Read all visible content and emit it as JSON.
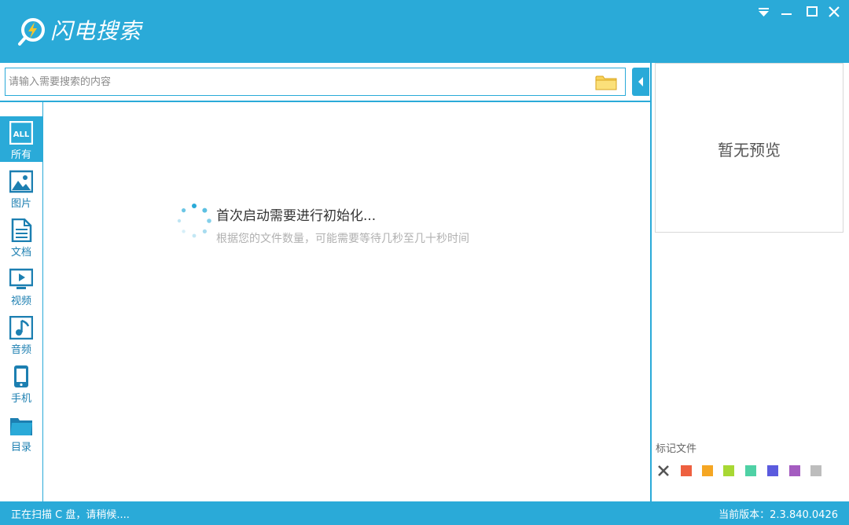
{
  "app": {
    "title": "闪电搜索",
    "accent_color": "#2aaad8"
  },
  "window_controls": [
    "dropdown-icon",
    "minimize-icon",
    "maximize-icon",
    "close-icon"
  ],
  "search": {
    "placeholder": "请输入需要搜索的内容",
    "value": "",
    "browse_icon": "folder-icon"
  },
  "sidebar": {
    "items": [
      {
        "label": "所有",
        "icon": "all-icon",
        "active": true
      },
      {
        "label": "图片",
        "icon": "picture-icon",
        "active": false
      },
      {
        "label": "文档",
        "icon": "document-icon",
        "active": false
      },
      {
        "label": "视频",
        "icon": "video-icon",
        "active": false
      },
      {
        "label": "音频",
        "icon": "audio-icon",
        "active": false
      },
      {
        "label": "手机",
        "icon": "phone-icon",
        "active": false
      },
      {
        "label": "目录",
        "icon": "folder-icon",
        "active": false
      }
    ]
  },
  "main": {
    "init_title": "首次启动需要进行初始化...",
    "init_subtitle": "根据您的文件数量，可能需要等待几秒至几十秒时间"
  },
  "preview": {
    "empty_text": "暂无预览"
  },
  "marks": {
    "title": "标记文件",
    "colors": [
      "#ee6040",
      "#f5a623",
      "#a8d834",
      "#4fd1a5",
      "#5b5bde",
      "#a45cc0",
      "#bdbdbd"
    ]
  },
  "status": {
    "left": "正在扫描 C 盘，请稍候....",
    "version": "当前版本：2.3.840.0426"
  },
  "icon_glyphs": {
    "all": "ALL"
  }
}
